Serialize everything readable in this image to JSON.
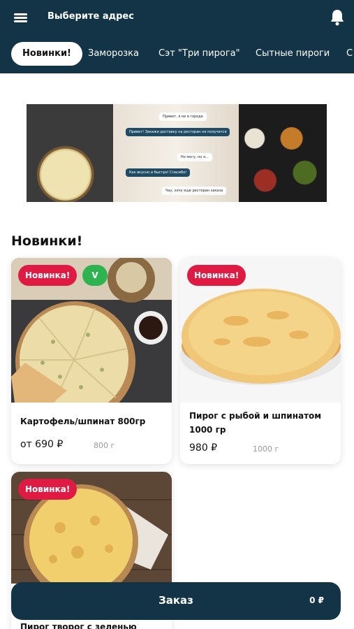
{
  "header": {
    "address_label": "Выберите адрес"
  },
  "tabs": [
    {
      "label": "Новинки!",
      "active": true
    },
    {
      "label": "Заморозка"
    },
    {
      "label": "Сэт \"Три пирога\""
    },
    {
      "label": "Сытные пироги"
    },
    {
      "label": "С"
    }
  ],
  "banner": {
    "chat_messages": [
      "Привет, я не в городе",
      "Привет! Закажи доставку на ресторан не получится",
      "Но могу, но я...",
      "Как вкусно и быстро! Спасибо!",
      "Чау, хочу еще ресторан заказа"
    ]
  },
  "section": {
    "title": "Новинки!"
  },
  "products": [
    {
      "name": "Картофель/шпинат 800гр",
      "price": "от 690 ₽",
      "weight": "800 г",
      "badge": "Новинка!",
      "veg_badge": "V"
    },
    {
      "name": "Пирог с рыбой и шпинатом 1000 гр",
      "price": "980 ₽",
      "weight": "1000 г",
      "badge": "Новинка!"
    },
    {
      "name": "Пирог творог с зеленью",
      "badge": "Новинка!"
    }
  ],
  "order": {
    "label": "Заказ",
    "total": "0 ₽"
  },
  "colors": {
    "header_bg": "#123446",
    "badge_new": "#e01b43",
    "badge_veg": "#2fb351",
    "order_bar": "#123446"
  }
}
